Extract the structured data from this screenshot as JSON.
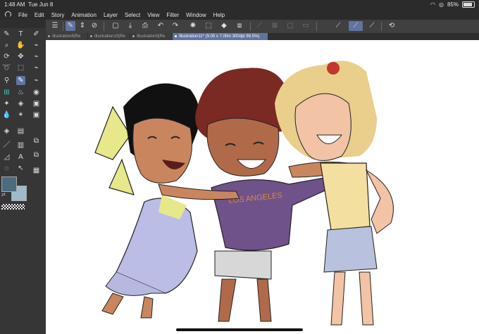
{
  "status": {
    "time": "1:48 AM",
    "date": "Tue Jun 8",
    "battery": "85%"
  },
  "menu": [
    "File",
    "Edit",
    "Story",
    "Animation",
    "Layer",
    "Select",
    "View",
    "Filter",
    "Window",
    "Help"
  ],
  "toolbar": {
    "icons": [
      "menu-icon",
      "pen-tool-icon",
      "updown-icon",
      "no-entry-icon",
      "new-file-icon",
      "save-icon",
      "print-icon",
      "undo-icon",
      "redo-icon",
      "spinner-icon",
      "lasso-select-icon",
      "fill-icon",
      "transform-icon",
      "deselect-icon",
      "invert-icon",
      "clear-icon",
      "ruler-pen-icon",
      "vector-pen-icon",
      "snap-pen-icon",
      "rotate-icon"
    ]
  },
  "tabs": [
    {
      "label": "Illustration8(Re",
      "active": false
    },
    {
      "label": "Illustration10(Re",
      "active": false
    },
    {
      "label": "Illustration9(Re",
      "active": false
    },
    {
      "label": "Illustration11* (9.00 x 7.00in 300dpi 98.5%)",
      "active": true
    }
  ],
  "colors": {
    "main": "#4b6b7f",
    "sub": "#9cbccc",
    "accent": "#5f74a0"
  }
}
